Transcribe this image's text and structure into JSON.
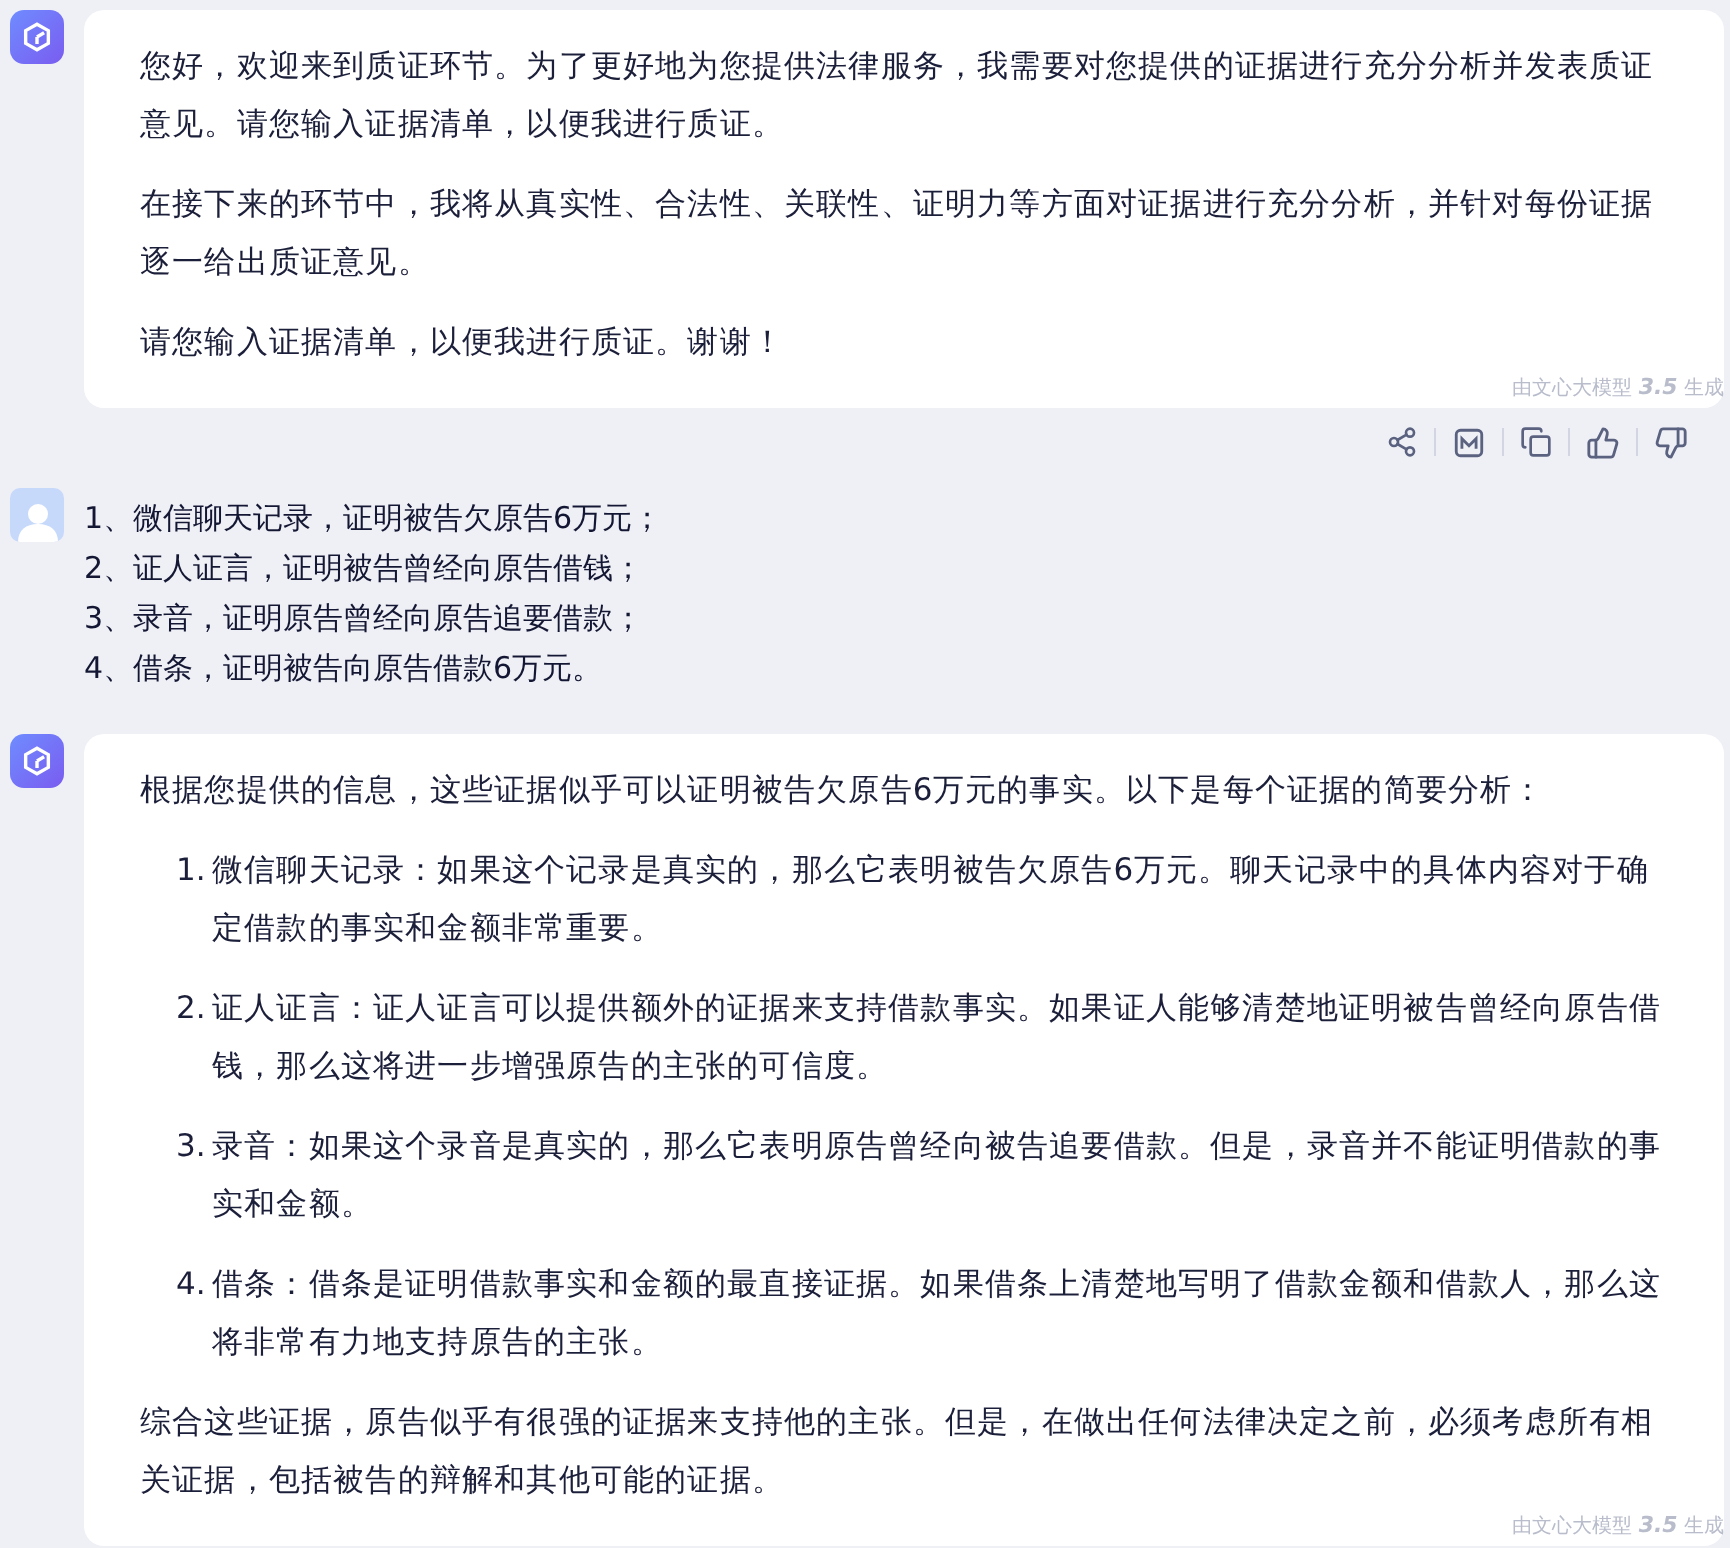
{
  "messages": [
    {
      "kind": "assistant",
      "paragraphs": [
        {
          "kind": "text",
          "text": "您好，欢迎来到质证环节。为了更好地为您提供法律服务，我需要对您提供的证据进行充分分析并发表质证意见。请您输入证据清单，以便我进行质证。"
        },
        {
          "kind": "text",
          "text": "在接下来的环节中，我将从真实性、合法性、关联性、证明力等方面对证据进行充分分析，并针对每份证据逐一给出质证意见。"
        },
        {
          "kind": "text",
          "text": "请您输入证据清单，以便我进行质证。谢谢！"
        }
      ],
      "footnote": "由文心大模型 **3.5** 生成",
      "actions": [
        {
          "kind": "share"
        },
        {
          "kind": "chart"
        },
        {
          "kind": "copy"
        },
        {
          "kind": "like"
        },
        {
          "kind": "dislike"
        }
      ]
    },
    {
      "kind": "user",
      "lines": [
        "1、微信聊天记录，证明被告欠原告6万元；",
        "2、证人证言，证明被告曾经向原告借钱；",
        "3、录音，证明原告曾经向原告追要借款；",
        "4、借条，证明被告向原告借款6万元。"
      ]
    },
    {
      "kind": "assistant",
      "paragraphs": [
        {
          "kind": "text",
          "text": "根据您提供的信息，这些证据似乎可以证明被告欠原告6万元的事实。以下是每个证据的简要分析："
        },
        {
          "kind": "list",
          "items": [
            {
              "number": "1.",
              "text": "微信聊天记录：如果这个记录是真实的，那么它表明被告欠原告6万元。聊天记录中的具体内容对于确定借款的事实和金额非常重要。"
            },
            {
              "number": "2.",
              "text": "证人证言：证人证言可以提供额外的证据来支持借款事实。如果证人能够清楚地证明被告曾经向原告借钱，那么这将进一步增强原告的主张的可信度。"
            },
            {
              "number": "3.",
              "text": "录音：如果这个录音是真实的，那么它表明原告曾经向被告追要借款。但是，录音并不能证明借款的事实和金额。"
            },
            {
              "number": "4.",
              "text": "借条：借条是证明借款事实和金额的最直接证据。如果借条上清楚地写明了借款金额和借款人，那么这将非常有力地支持原告的主张。"
            }
          ]
        },
        {
          "kind": "text",
          "text": "综合这些证据，原告似乎有很强的证据来支持他的主张。但是，在做出任何法律决定之前，必须考虑所有相关证据，包括被告的辩解和其他可能的证据。"
        }
      ],
      "footnote": "由文心大模型 **3.5** 生成"
    }
  ]
}
